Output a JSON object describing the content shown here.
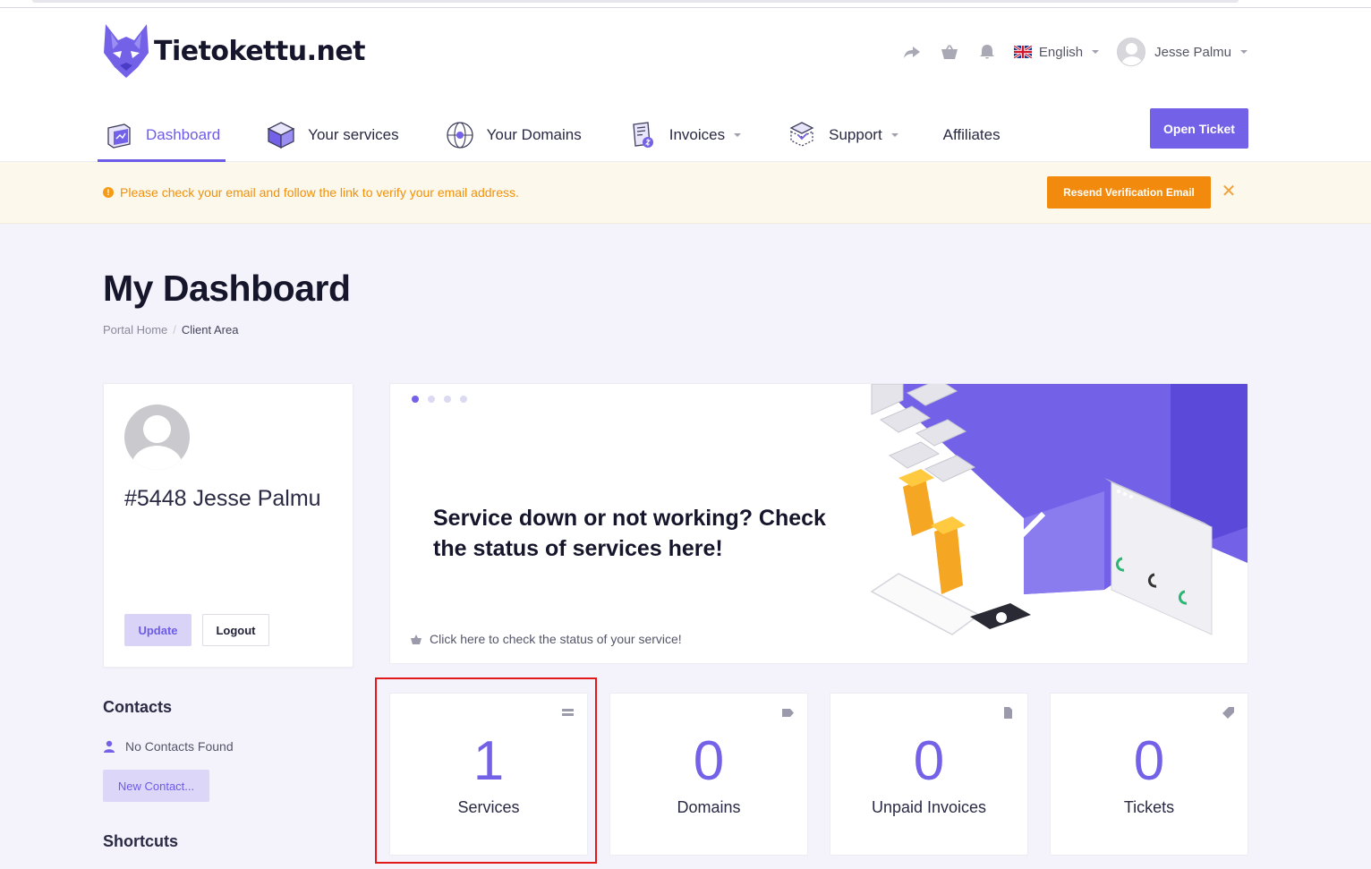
{
  "brand": {
    "name": "Tietokettu.net",
    "accent": "#7362e8",
    "warning": "#f28b0d"
  },
  "topbar": {
    "icons": [
      "share-icon",
      "basket-icon",
      "bell-icon"
    ],
    "language": "English",
    "user_name": "Jesse Palmu"
  },
  "nav": {
    "items": [
      {
        "label": "Dashboard",
        "icon": "dashboard-icon",
        "active": true
      },
      {
        "label": "Your services",
        "icon": "box-icon"
      },
      {
        "label": "Your Domains",
        "icon": "globe-icon"
      },
      {
        "label": "Invoices",
        "icon": "invoice-icon",
        "dropdown": true
      },
      {
        "label": "Support",
        "icon": "support-icon",
        "dropdown": true
      },
      {
        "label": "Affiliates"
      }
    ],
    "open_ticket_label": "Open Ticket"
  },
  "alert": {
    "message": "Please check your email and follow the link to verify your email address.",
    "button_label": "Resend Verification Email",
    "close_glyph": "✕"
  },
  "page": {
    "title": "My Dashboard",
    "breadcrumb": [
      "Portal Home",
      "Client Area"
    ]
  },
  "profile": {
    "name": "#5448 Jesse Palmu",
    "update_label": "Update",
    "logout_label": "Logout"
  },
  "contacts": {
    "title": "Contacts",
    "empty_text": "No Contacts Found",
    "new_button_label": "New Contact..."
  },
  "shortcuts": {
    "title": "Shortcuts"
  },
  "promo": {
    "headline": "Service down or not working? Check the status of services here!",
    "link_text": "Click here to check the status of your service!",
    "slide_count": 4,
    "active_slide": 1
  },
  "stats": [
    {
      "value": "1",
      "label": "Services",
      "icon": "server-icon"
    },
    {
      "value": "0",
      "label": "Domains",
      "icon": "tag-icon"
    },
    {
      "value": "0",
      "label": "Unpaid Invoices",
      "icon": "document-icon"
    },
    {
      "value": "0",
      "label": "Tickets",
      "icon": "ticket-icon"
    }
  ]
}
